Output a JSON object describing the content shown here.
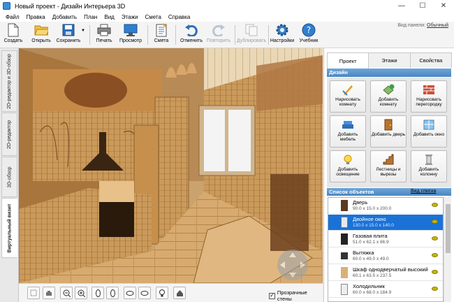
{
  "window": {
    "title": "Новый проект - Дизайн Интерьера 3D"
  },
  "menu": [
    "Файл",
    "Правка",
    "Добавить",
    "План",
    "Вид",
    "Этажи",
    "Смета",
    "Справка"
  ],
  "toolbar": {
    "create": "Создать",
    "open": "Открыть",
    "save": "Сохранить",
    "print": "Печать",
    "preview": "Просмотр",
    "estimate": "Смета",
    "undo": "Отменить",
    "redo": "Повторить",
    "duplicate": "Дублировать",
    "settings": "Настройки",
    "tutorial": "Учебник",
    "panel_view_label": "Вид панели:",
    "panel_view_value": "Обычный"
  },
  "side_tabs": [
    "2D-редактор и 3D-обзор",
    "2D-редактор",
    "3D-обзор",
    "Виртуальный визит"
  ],
  "right_tabs": [
    "Проект",
    "Этажи",
    "Свойства"
  ],
  "design": {
    "header": "Дизайн",
    "buttons": [
      "Нарисовать комнату",
      "Добавить комнату",
      "Нарисовать перегородку",
      "Добавить мебель",
      "Добавить дверь",
      "Добавить окно",
      "Добавить освещение",
      "Лестницы и вырезы",
      "Добавить колонну"
    ]
  },
  "objects": {
    "header": "Список объектов",
    "view_list": "Вид списка",
    "items": [
      {
        "name": "Дверь",
        "size": "90.0 x 15.0 x 200.0"
      },
      {
        "name": "Двойное окно",
        "size": "130.0 x 15.0 x 140.0",
        "selected": true
      },
      {
        "name": "Газовая плита",
        "size": "51.0 x 62.1 x 86.9"
      },
      {
        "name": "Вытяжка",
        "size": "60.0 x 49.0 x 49.0"
      },
      {
        "name": "Шкаф однодверчатый высокий",
        "size": "60.1 x 63.5 x 237.5"
      },
      {
        "name": "Холодильник",
        "size": "60.0 x 68.0 x 184.9"
      }
    ]
  },
  "bottom": {
    "transparent_walls": "Прозрачные стены",
    "transparent_checked": true
  },
  "colors": {
    "accent": "#1a72d6",
    "header_blue": "#4a86c2"
  }
}
